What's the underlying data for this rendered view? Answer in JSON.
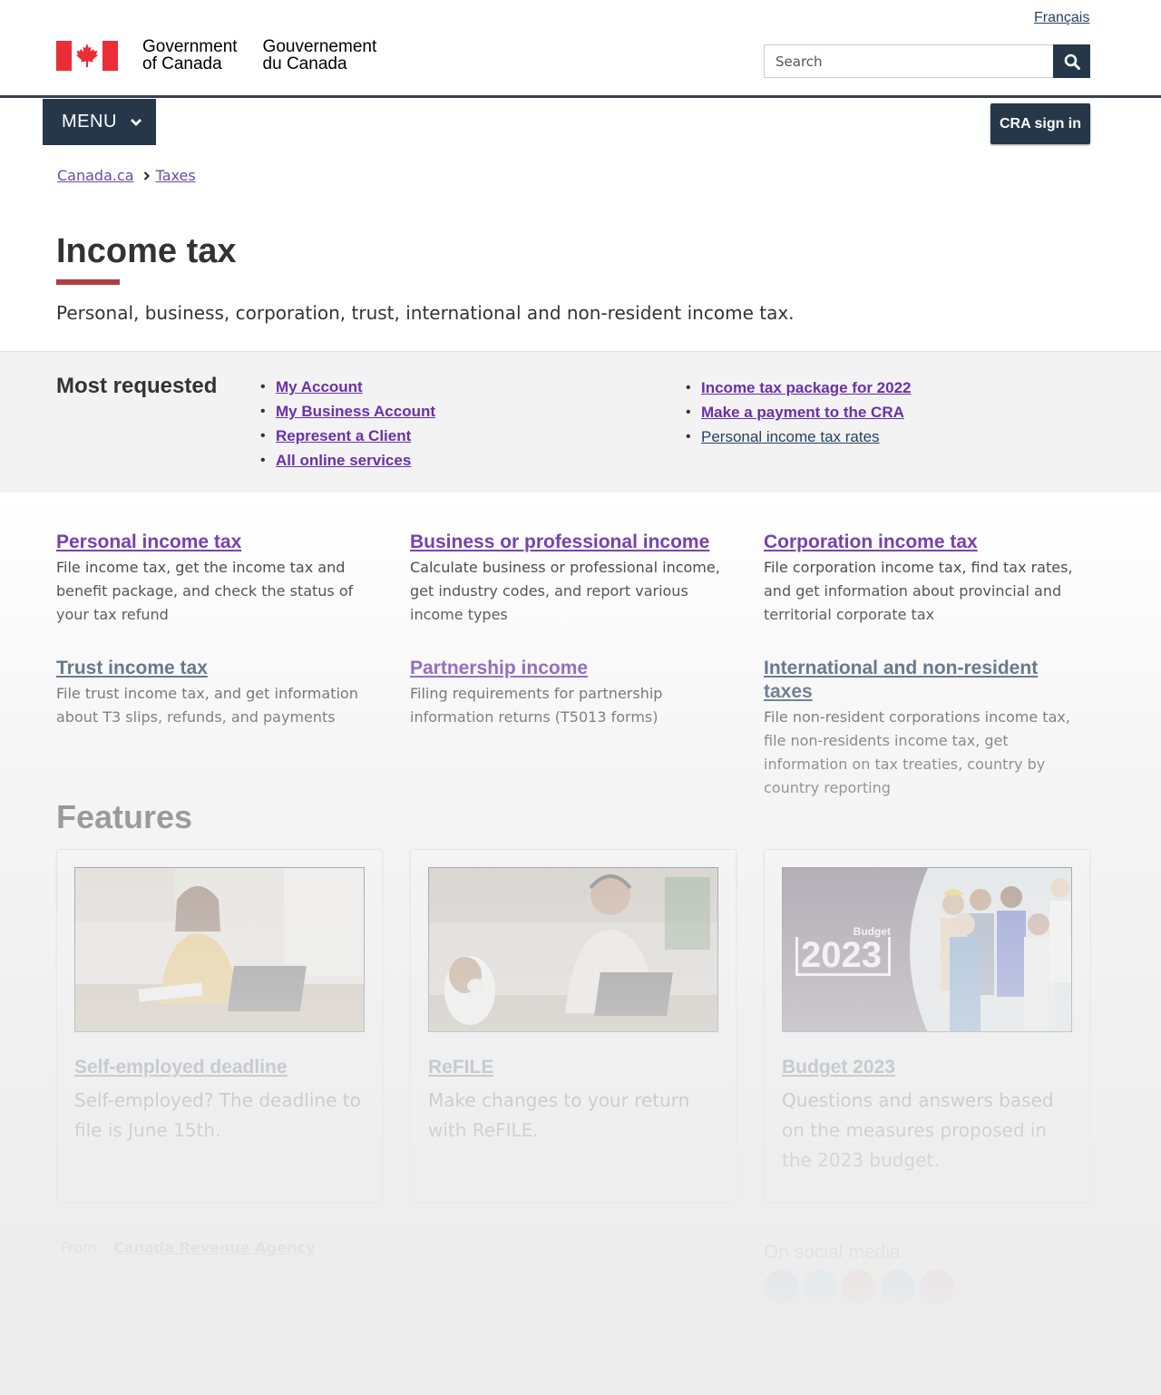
{
  "header": {
    "language_link": "Français",
    "wordmark_en_1": "Government",
    "wordmark_en_2": "of Canada",
    "wordmark_fr_1": "Gouvernement",
    "wordmark_fr_2": "du Canada",
    "search_placeholder": "Search",
    "menu_label": "MENU",
    "signin_label": "CRA sign in"
  },
  "breadcrumb": [
    "Canada.ca",
    "Taxes"
  ],
  "page": {
    "title": "Income tax",
    "intro": "Personal, business, corporation, trust, international and non-resident income tax."
  },
  "most_requested": {
    "heading": "Most requested",
    "col1": [
      "My Account",
      "My Business Account",
      "Represent a Client",
      "All online services"
    ],
    "col2": [
      "Income tax package for 2022",
      "Make a payment to the CRA",
      "Personal income tax rates"
    ]
  },
  "services": [
    {
      "title": "Personal income tax",
      "desc": "File income tax, get the income tax and benefit package, and check the status of your tax refund"
    },
    {
      "title": "Business or professional income",
      "desc": "Calculate business or professional income, get industry codes, and report various income types"
    },
    {
      "title": "Corporation income tax",
      "desc": "File corporation income tax, find tax rates, and get information about provincial and territorial corporate tax"
    },
    {
      "title": "Trust income tax",
      "desc": "File trust income tax, and get information about T3 slips, refunds, and payments"
    },
    {
      "title": "Partnership income",
      "desc": "Filing requirements for partnership information returns (T5013 forms)"
    },
    {
      "title": "International and non-resident taxes",
      "desc": "File non-resident corporations income tax, file non-residents income tax, get information on tax treaties, country by country reporting"
    }
  ],
  "features": {
    "heading": "Features",
    "cards": [
      {
        "title": "Self-employed deadline",
        "desc": "Self-employed? The deadline to file is June 15th."
      },
      {
        "title": "ReFILE",
        "desc": "Make changes to your return with ReFILE."
      },
      {
        "title": "Budget 2023",
        "desc": "Questions and answers based on the measures proposed in the 2023 budget.",
        "image_text_small": "Budget",
        "image_text_big": "2023"
      }
    ]
  },
  "footer": {
    "from_label": "From:",
    "from_link": "Canada Revenue Agency",
    "social_heading": "On social media",
    "social_icons": [
      "facebook-icon",
      "twitter-icon",
      "youtube-icon",
      "linkedin-icon",
      "instagram-icon"
    ]
  },
  "colors": {
    "brand_red": "#eb2d37",
    "nav_dark": "#26374a",
    "link_purple": "#6a30a8",
    "title_rule": "#af3c43"
  }
}
